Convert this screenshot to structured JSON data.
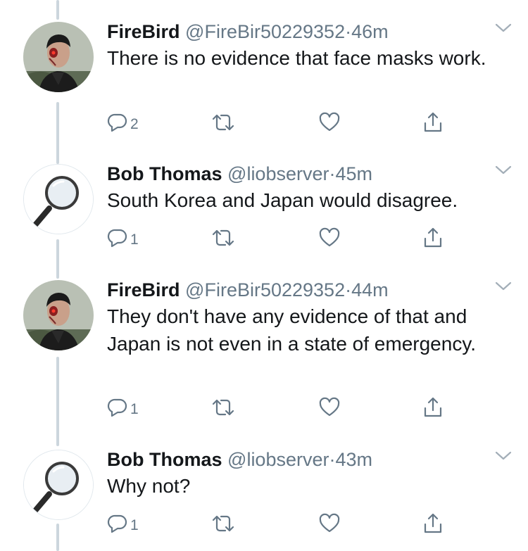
{
  "tweets": [
    {
      "name": "FireBird",
      "handle": "@FireBir50229352",
      "separator": "·",
      "time": "46m",
      "text": "There is no evidence that face masks work.",
      "replies": "2",
      "avatar": "terminator-avatar"
    },
    {
      "name": "Bob Thomas",
      "handle": "@liobserver",
      "separator": "·",
      "time": "45m",
      "text": "South Korea and Japan would disagree.",
      "replies": "1",
      "avatar": "magnifying-glass-avatar"
    },
    {
      "name": "FireBird",
      "handle": "@FireBir50229352",
      "separator": "·",
      "time": "44m",
      "text": "They don't have any evidence of that and Japan is not even in a state of emergency.",
      "replies": "1",
      "avatar": "terminator-avatar"
    },
    {
      "name": "Bob Thomas",
      "handle": "@liobserver",
      "separator": "·",
      "time": "43m",
      "text": "Why not?",
      "replies": "1",
      "avatar": "magnifying-glass-avatar"
    }
  ],
  "colors": {
    "text": "#14171a",
    "secondary": "#657786",
    "thread_line": "#ccd6dd"
  },
  "icons": [
    "reply-icon",
    "retweet-icon",
    "like-icon",
    "share-icon",
    "chevron-down-icon"
  ]
}
